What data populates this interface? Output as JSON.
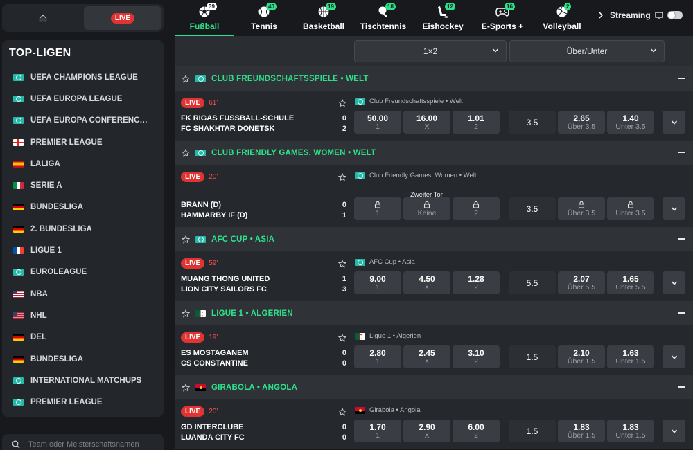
{
  "sidebar": {
    "top_live_label": "LIVE",
    "title": "TOP-LIGEN",
    "leagues": [
      {
        "name": "UEFA CHAMPIONS LEAGUE",
        "flag": "globe"
      },
      {
        "name": "UEFA EUROPA LEAGUE",
        "flag": "globe"
      },
      {
        "name": "UEFA EUROPA CONFERENCE L...",
        "flag": "globe"
      },
      {
        "name": "PREMIER LEAGUE",
        "flag": "eng"
      },
      {
        "name": "LALIGA",
        "flag": "es"
      },
      {
        "name": "SERIE A",
        "flag": "it"
      },
      {
        "name": "BUNDESLIGA",
        "flag": "de"
      },
      {
        "name": "2. BUNDESLIGA",
        "flag": "de"
      },
      {
        "name": "LIGUE 1",
        "flag": "fr"
      },
      {
        "name": "EUROLEAGUE",
        "flag": "globe"
      },
      {
        "name": "NBA",
        "flag": "us"
      },
      {
        "name": "NHL",
        "flag": "us"
      },
      {
        "name": "DEL",
        "flag": "de"
      },
      {
        "name": "BUNDESLIGA",
        "flag": "de"
      },
      {
        "name": "INTERNATIONAL MATCHUPS",
        "flag": "globe"
      },
      {
        "name": "PREMIER LEAGUE",
        "flag": "globe"
      }
    ],
    "search_placeholder": "Team oder Meisterschaftsnamen"
  },
  "sports": [
    {
      "label": "Fußball",
      "count": "39",
      "icon": "soccer-ball-icon"
    },
    {
      "label": "Tennis",
      "count": "40",
      "icon": "tennis-ball-icon"
    },
    {
      "label": "Basketball",
      "count": "19",
      "icon": "basketball-icon"
    },
    {
      "label": "Tischtennis",
      "count": "18",
      "icon": "table-tennis-icon"
    },
    {
      "label": "Eishockey",
      "count": "12",
      "icon": "ice-hockey-icon"
    },
    {
      "label": "E-Sports +",
      "count": "16",
      "icon": "gamepad-icon"
    },
    {
      "label": "Volleyball",
      "count": "2",
      "icon": "volleyball-icon"
    }
  ],
  "streaming_label": "Streaming",
  "markets": {
    "main": "1×2",
    "second": "Über/Unter"
  },
  "accent_color": "#2fe08a",
  "groups": [
    {
      "title": "CLUB FREUNDSCHAFTSSPIELE • WELT",
      "flag": "globe",
      "event": {
        "live": "LIVE",
        "minute": "61'",
        "league": "Club Freundschaftsspiele • Welt",
        "home": "FK RIGAS FUSSBALL-SCHULE",
        "away": "FC SHAKHTAR DONETSK",
        "home_score": "0",
        "away_score": "2",
        "note": "",
        "odds": [
          {
            "v": "50.00",
            "s": "1"
          },
          {
            "v": "16.00",
            "s": "X"
          },
          {
            "v": "1.01",
            "s": "2"
          }
        ],
        "line": "3.5",
        "ou": [
          {
            "v": "2.65",
            "s": "Über 3.5"
          },
          {
            "v": "1.40",
            "s": "Unter 3.5"
          }
        ],
        "locked": false
      }
    },
    {
      "title": "CLUB FRIENDLY GAMES, WOMEN • WELT",
      "flag": "globe",
      "event": {
        "live": "LIVE",
        "minute": "20'",
        "league": "Club Friendly Games, Women • Welt",
        "home": "BRANN (D)",
        "away": "HAMMARBY IF (D)",
        "home_score": "0",
        "away_score": "1",
        "note": "Zweiter Tor",
        "odds": [
          {
            "v": "",
            "s": "1"
          },
          {
            "v": "",
            "s": "Keine"
          },
          {
            "v": "",
            "s": "2"
          }
        ],
        "line": "3.5",
        "ou": [
          {
            "v": "",
            "s": "Über 3.5"
          },
          {
            "v": "",
            "s": "Unter 3.5"
          }
        ],
        "locked": true
      }
    },
    {
      "title": "AFC CUP • ASIA",
      "flag": "globe",
      "event": {
        "live": "LIVE",
        "minute": "59'",
        "league": "AFC Cup • Asia",
        "home": "MUANG THONG UNITED",
        "away": "LION CITY SAILORS FC",
        "home_score": "1",
        "away_score": "3",
        "note": "",
        "odds": [
          {
            "v": "9.00",
            "s": "1"
          },
          {
            "v": "4.50",
            "s": "X"
          },
          {
            "v": "1.28",
            "s": "2"
          }
        ],
        "line": "5.5",
        "ou": [
          {
            "v": "2.07",
            "s": "Über 5.5"
          },
          {
            "v": "1.65",
            "s": "Unter 5.5"
          }
        ],
        "locked": false
      }
    },
    {
      "title": "LIGUE 1 • ALGERIEN",
      "flag": "dz",
      "event": {
        "live": "LIVE",
        "minute": "19'",
        "league": "Ligue 1 • Algerien",
        "home": "ES MOSTAGANEM",
        "away": "CS CONSTANTINE",
        "home_score": "0",
        "away_score": "0",
        "note": "",
        "odds": [
          {
            "v": "2.80",
            "s": "1"
          },
          {
            "v": "2.45",
            "s": "X"
          },
          {
            "v": "3.10",
            "s": "2"
          }
        ],
        "line": "1.5",
        "ou": [
          {
            "v": "2.10",
            "s": "Über 1.5"
          },
          {
            "v": "1.63",
            "s": "Unter 1.5"
          }
        ],
        "locked": false
      }
    },
    {
      "title": "GIRABOLA • ANGOLA",
      "flag": "ao",
      "event": {
        "live": "LIVE",
        "minute": "20'",
        "league": "Girabola • Angola",
        "home": "GD INTERCLUBE",
        "away": "LUANDA CITY FC",
        "home_score": "0",
        "away_score": "0",
        "note": "",
        "odds": [
          {
            "v": "1.70",
            "s": "1"
          },
          {
            "v": "2.90",
            "s": "X"
          },
          {
            "v": "6.00",
            "s": "2"
          }
        ],
        "line": "1.5",
        "ou": [
          {
            "v": "1.83",
            "s": "Über 1.5"
          },
          {
            "v": "1.83",
            "s": "Unter 1.5"
          }
        ],
        "locked": false
      }
    }
  ]
}
